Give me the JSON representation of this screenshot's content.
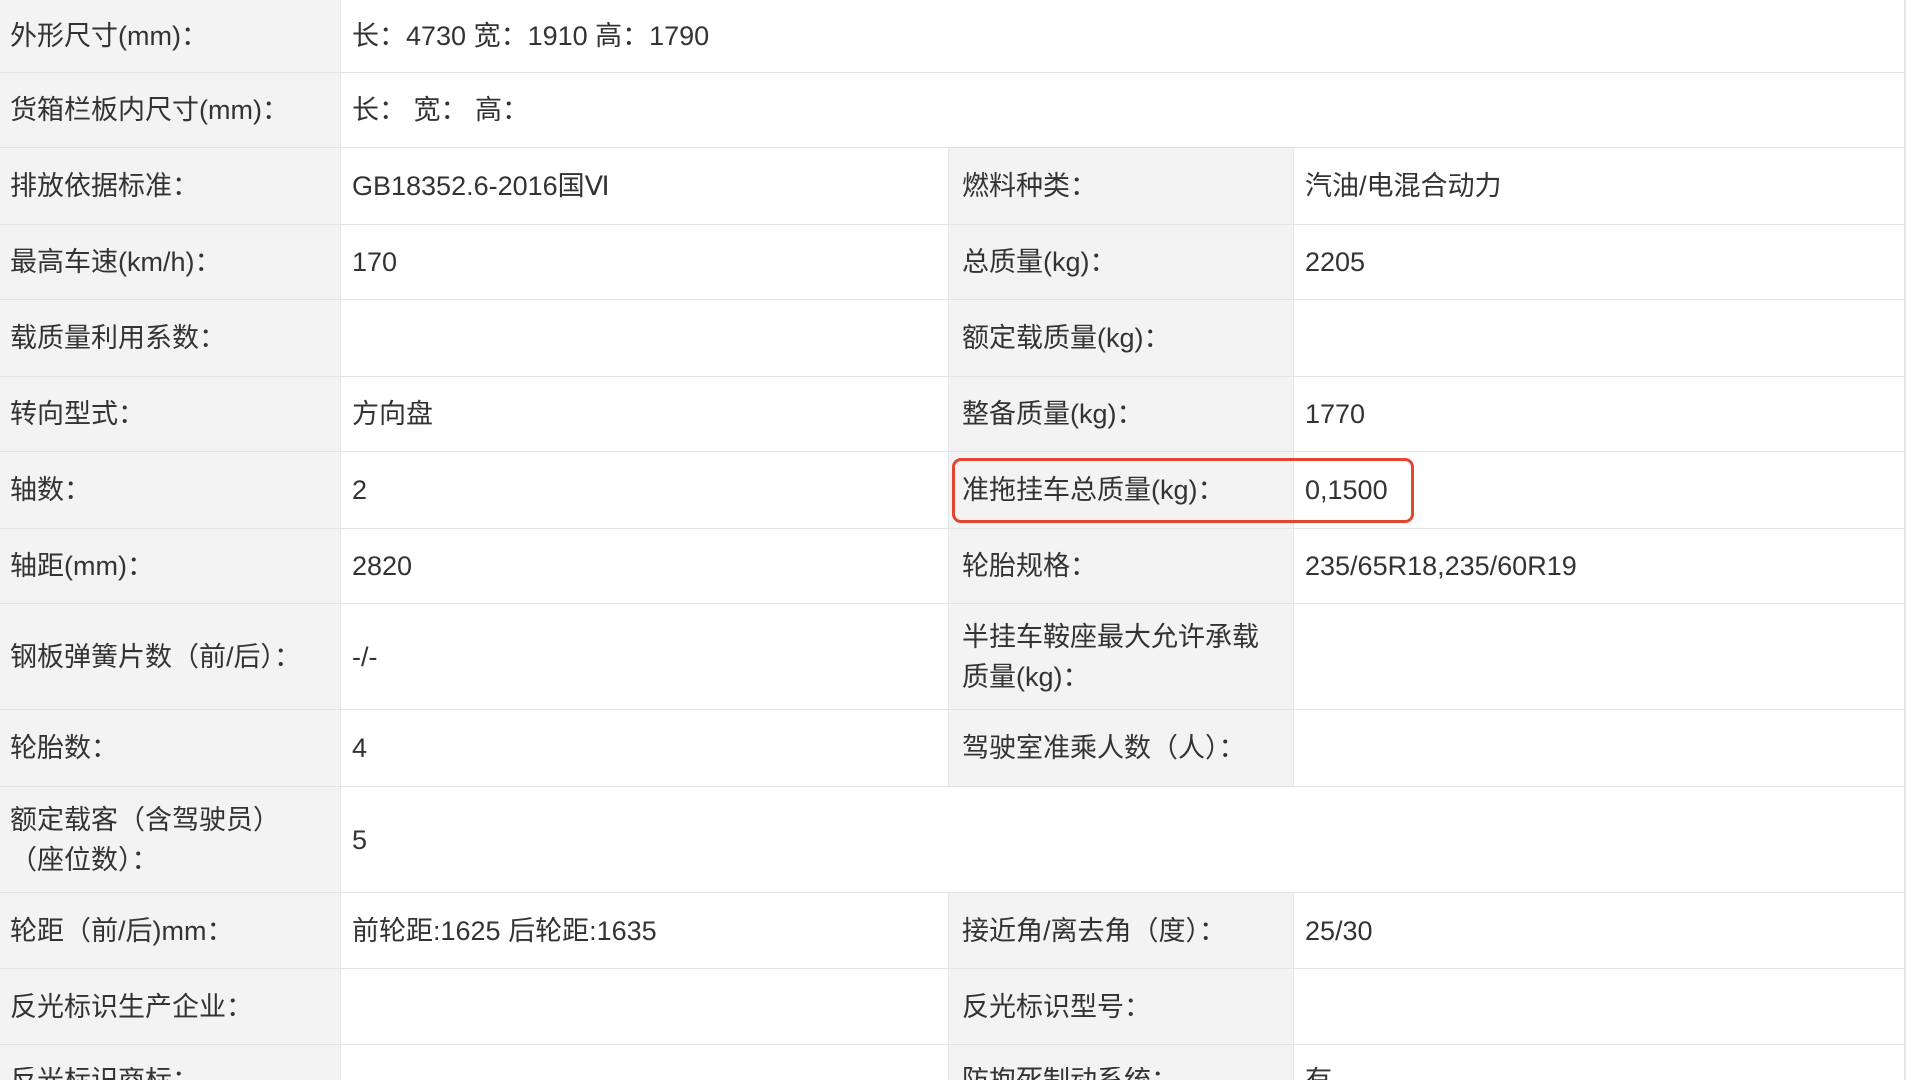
{
  "rows": [
    {
      "label": "外形尺寸(mm)：",
      "value": "长：4730 宽：1910 高：1790"
    },
    {
      "label": "货箱栏板内尺寸(mm)：",
      "value": "长： 宽： 高："
    },
    {
      "label": "排放依据标准：",
      "value": "GB18352.6-2016国Ⅵ",
      "label2": "燃料种类：",
      "value2": "汽油/电混合动力"
    },
    {
      "label": "最高车速(km/h)：",
      "value": "170",
      "label2": "总质量(kg)：",
      "value2": "2205"
    },
    {
      "label": "载质量利用系数：",
      "value": "",
      "label2": "额定载质量(kg)：",
      "value2": ""
    },
    {
      "label": "转向型式：",
      "value": "方向盘",
      "label2": "整备质量(kg)：",
      "value2": "1770"
    },
    {
      "label": "轴数：",
      "value": "2",
      "label2": "准拖挂车总质量(kg)：",
      "value2": "0,1500"
    },
    {
      "label": "轴距(mm)：",
      "value": "2820",
      "label2": "轮胎规格：",
      "value2": "235/65R18,235/60R19"
    },
    {
      "label": "钢板弹簧片数（前/后）：",
      "value": "-/-",
      "label2": "半挂车鞍座最大允许承载质量(kg)：",
      "value2": ""
    },
    {
      "label": "轮胎数：",
      "value": "4",
      "label2": "驾驶室准乘人数（人）：",
      "value2": ""
    },
    {
      "label": "额定载客（含驾驶员）（座位数）：",
      "value": "5"
    },
    {
      "label": "轮距（前/后)mm：",
      "value": "前轮距:1625 后轮距:1635",
      "label2": "接近角/离去角（度）：",
      "value2": "25/30"
    },
    {
      "label": "反光标识生产企业：",
      "value": "",
      "label2": "反光标识型号：",
      "value2": ""
    },
    {
      "label": "反光标识商标：",
      "value": "",
      "label2": "防抱死制动系统：",
      "value2": "有"
    }
  ],
  "highlight": {
    "color": "#e2462f"
  },
  "colors": {
    "label_bg": "#f3f3f3",
    "value_bg": "#ffffff",
    "border": "#e3e3e3",
    "text": "#333333"
  }
}
